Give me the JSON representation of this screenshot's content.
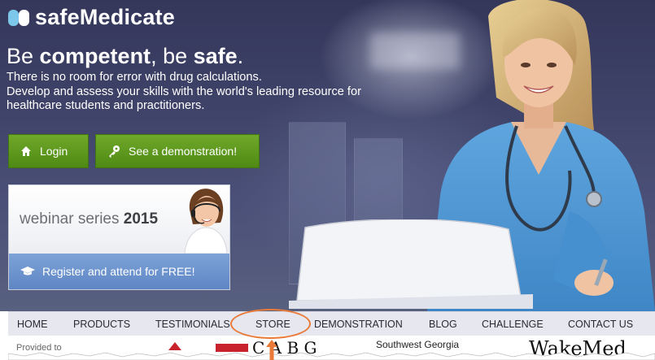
{
  "brand": {
    "name": "safeMedicate"
  },
  "hero": {
    "tagline_part1": "Be ",
    "tagline_strong1": "competent",
    "tagline_part2": ", be ",
    "tagline_strong2": "safe",
    "tagline_end": ".",
    "intro_lines": [
      "There is no room for error with drug calculations.",
      "Develop and assess your skills with the world's leading resource for",
      "healthcare students and practitioners."
    ]
  },
  "buttons": {
    "login": "Login",
    "demo": "See a demonstration!"
  },
  "webinar": {
    "title": "webinar series",
    "year": "2015",
    "register": "Register and attend for FREE!"
  },
  "nav": {
    "items": [
      "HOME",
      "PRODUCTS",
      "TESTIMONIALS",
      "STORE",
      "DEMONSTRATION",
      "BLOG",
      "CHALLENGE",
      "CONTACT US"
    ]
  },
  "partners": {
    "label": "Provided to",
    "swg": "Southwest Georgia",
    "wake": "WakeMed"
  },
  "colors": {
    "button_green": "#5c9a1b",
    "webinar_blue": "#6b91cc",
    "highlight_orange": "#ea7a38"
  },
  "icons": {
    "login": "home-icon",
    "demo": "key-icon",
    "register": "graduation-cap-icon"
  }
}
